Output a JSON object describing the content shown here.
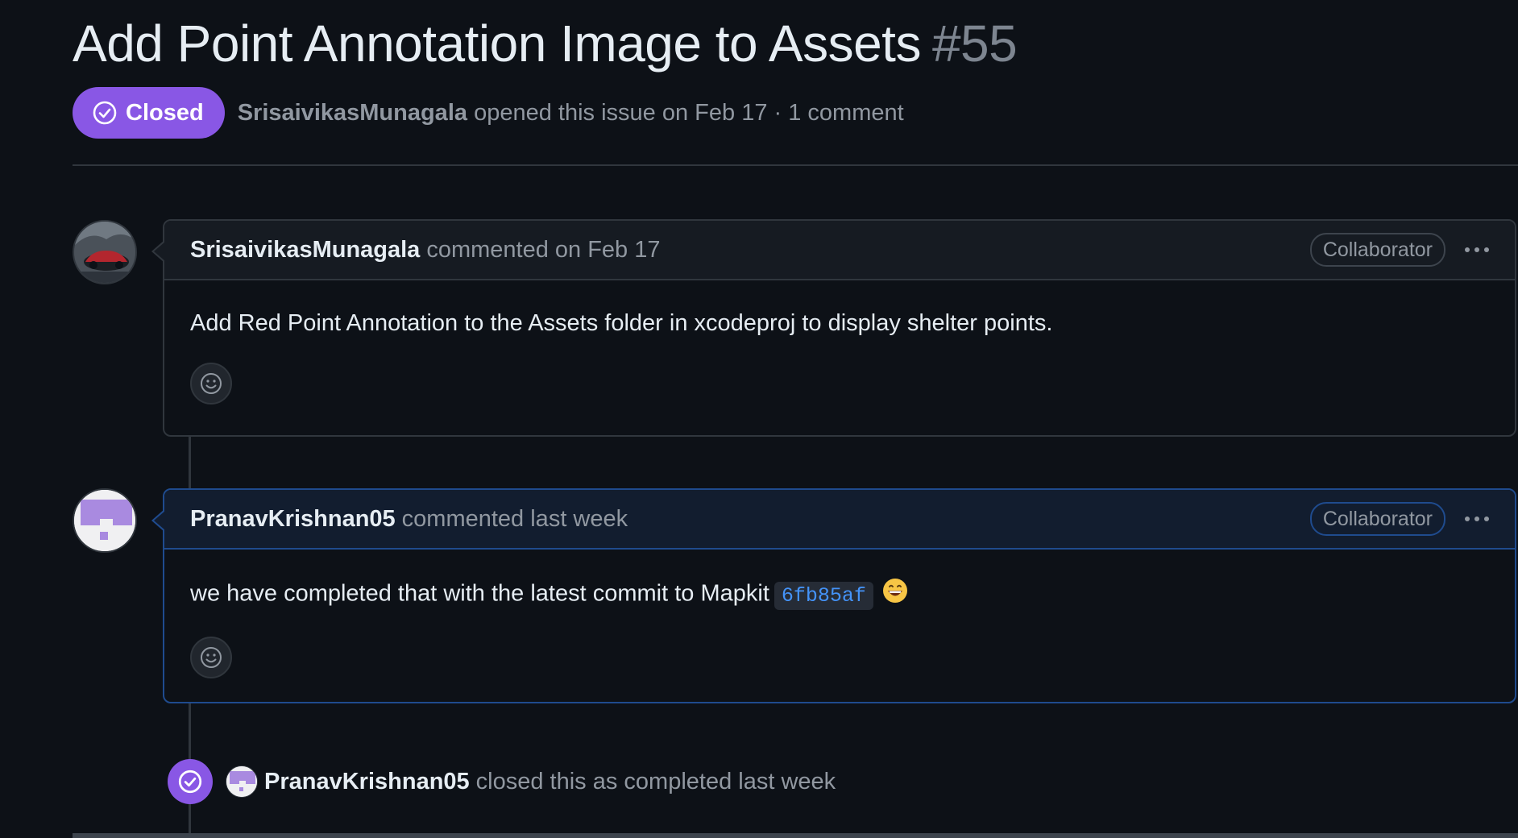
{
  "issue": {
    "title": "Add Point Annotation Image to Assets",
    "number": "#55",
    "state_label": "Closed",
    "author": "SrisaivikasMunagala",
    "opened_text": "opened this issue on Feb 17 · 1 comment"
  },
  "comments": [
    {
      "author": "SrisaivikasMunagala",
      "time_text": "commented on Feb 17",
      "role": "Collaborator",
      "body": "Add Red Point Annotation to the Assets folder in xcodeproj to display shelter points."
    },
    {
      "author": "PranavKrishnan05",
      "time_text": "commented last week",
      "role": "Collaborator",
      "body": "we have completed that with the latest commit to Mapkit",
      "commit_sha": "6fb85af",
      "emoji": "grinning-face-emoji"
    }
  ],
  "event": {
    "actor": "PranavKrishnan05",
    "text": "closed this as completed last week"
  },
  "colors": {
    "background": "#0d1117",
    "closed_purple": "#8957e5",
    "muted": "#9198a1",
    "link_blue": "#4493f8",
    "highlight_border": "#1f4b8e"
  },
  "icons": [
    "check-circle-icon",
    "kebab-menu-icon",
    "smiley-icon",
    "identicon-avatar",
    "profile-avatar"
  ]
}
